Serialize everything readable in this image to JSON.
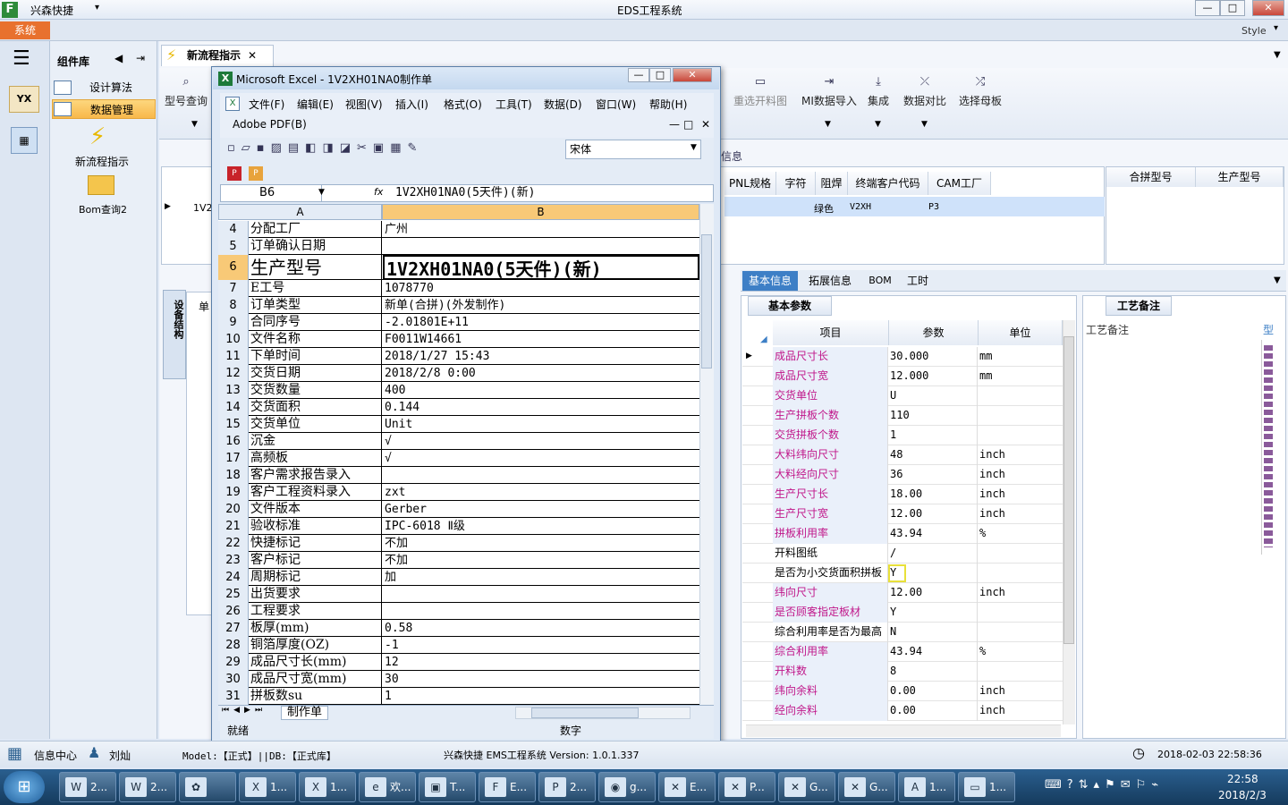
{
  "app": {
    "title": "EDS工程系统",
    "company": "兴森快捷",
    "style_label": "Style",
    "system_tab": "系统"
  },
  "window_controls": {
    "min": "—",
    "max": "□",
    "close": "✕"
  },
  "nav": {
    "header": "组件库",
    "items": [
      {
        "label": "设计算法"
      },
      {
        "label": "数据管理"
      }
    ],
    "tiles": [
      {
        "label": "新流程指示"
      },
      {
        "label": "Bom查询2"
      }
    ]
  },
  "main_tab": {
    "label": "新流程指示"
  },
  "toolbar": {
    "model_query": "型号查询",
    "buttons": [
      {
        "label": "重选开料图"
      },
      {
        "label": "MI数据导入"
      },
      {
        "label": "集成"
      },
      {
        "label": "数据对比"
      },
      {
        "label": "选择母板"
      }
    ]
  },
  "grid": {
    "info_label": "信息",
    "headers": [
      "PNL规格",
      "字符",
      "阻焊",
      "终端客户代码",
      "CAM工厂"
    ],
    "row_prefix": "1V2",
    "row": {
      "mask": "绿色",
      "code": "V2XH",
      "factory": "P3"
    },
    "right_headers": [
      "合拼型号",
      "生产型号"
    ]
  },
  "info_tabs": [
    "基本信息",
    "拓展信息",
    "BOM",
    "工时"
  ],
  "left_panel": {
    "tab": "单",
    "side": "设备结构"
  },
  "params": {
    "tab": "基本参数",
    "headers": {
      "item": "项目",
      "param": "参数",
      "unit": "单位"
    },
    "rows": [
      {
        "k": "成品尺寸长",
        "v": "30.000",
        "u": "mm",
        "m": true
      },
      {
        "k": "成品尺寸宽",
        "v": "12.000",
        "u": "mm",
        "m": true
      },
      {
        "k": "交货单位",
        "v": "U",
        "u": "",
        "m": true
      },
      {
        "k": "生产拼板个数",
        "v": "110",
        "u": "",
        "m": true
      },
      {
        "k": "交货拼板个数",
        "v": "1",
        "u": "",
        "m": true
      },
      {
        "k": "大料纬向尺寸",
        "v": "48",
        "u": "inch",
        "m": true
      },
      {
        "k": "大料经向尺寸",
        "v": "36",
        "u": "inch",
        "m": true
      },
      {
        "k": "生产尺寸长",
        "v": "18.00",
        "u": "inch",
        "m": true
      },
      {
        "k": "生产尺寸宽",
        "v": "12.00",
        "u": "inch",
        "m": true
      },
      {
        "k": "拼板利用率",
        "v": "43.94",
        "u": "%",
        "m": true
      },
      {
        "k": "开料图纸",
        "v": "/",
        "u": "",
        "m": false
      },
      {
        "k": "是否为小交货面积拼板",
        "v": "Y",
        "u": "",
        "m": false
      },
      {
        "k": "纬向尺寸",
        "v": "12.00",
        "u": "inch",
        "m": true
      },
      {
        "k": "是否顾客指定板材",
        "v": "Y",
        "u": "",
        "m": true
      },
      {
        "k": "综合利用率是否为最高",
        "v": "N",
        "u": "",
        "m": false
      },
      {
        "k": "综合利用率",
        "v": "43.94",
        "u": "%",
        "m": true
      },
      {
        "k": "开料数",
        "v": "8",
        "u": "",
        "m": true
      },
      {
        "k": "纬向余料",
        "v": "0.00",
        "u": "inch",
        "m": true
      },
      {
        "k": "经向余料",
        "v": "0.00",
        "u": "inch",
        "m": true
      }
    ]
  },
  "craft": {
    "tab": "工艺备注",
    "header": "工艺备注",
    "col": "型"
  },
  "excel": {
    "title": "Microsoft Excel - 1V2XH01NA0制作单",
    "menu": [
      "文件(F)",
      "编辑(E)",
      "视图(V)",
      "插入(I)",
      "格式(O)",
      "工具(T)",
      "数据(D)",
      "窗口(W)",
      "帮助(H)"
    ],
    "menu2": "Adobe PDF(B)",
    "font": "宋体",
    "cell_ref": "B6",
    "fx": "fx",
    "formula": "1V2XH01NA0(5天件)(新)",
    "col_a": "A",
    "col_b": "B",
    "rows": [
      {
        "n": "4",
        "a": "分配工厂",
        "b": "广州"
      },
      {
        "n": "5",
        "a": "订单确认日期",
        "b": ""
      },
      {
        "n": "6",
        "a": "生产型号",
        "b": "1V2XH01NA0(5天件)(新)",
        "big": true
      },
      {
        "n": "7",
        "a": "E工号",
        "b": "1078770"
      },
      {
        "n": "8",
        "a": "订单类型",
        "b": "新单(合拼)(外发制作)"
      },
      {
        "n": "9",
        "a": "合同序号",
        "b": "-2.01801E+11"
      },
      {
        "n": "10",
        "a": "文件名称",
        "b": "F0011W14661"
      },
      {
        "n": "11",
        "a": "下单时间",
        "b": "2018/1/27 15:43"
      },
      {
        "n": "12",
        "a": "交货日期",
        "b": "2018/2/8 0:00"
      },
      {
        "n": "13",
        "a": "交货数量",
        "b": "400"
      },
      {
        "n": "14",
        "a": "交货面积",
        "b": "0.144"
      },
      {
        "n": "15",
        "a": "交货单位",
        "b": "Unit"
      },
      {
        "n": "16",
        "a": "沉金",
        "b": "√"
      },
      {
        "n": "17",
        "a": "高频板",
        "b": "√"
      },
      {
        "n": "18",
        "a": "客户需求报告录入",
        "b": ""
      },
      {
        "n": "19",
        "a": "客户工程资料录入",
        "b": "zxt"
      },
      {
        "n": "20",
        "a": "文件版本",
        "b": "Gerber"
      },
      {
        "n": "21",
        "a": "验收标准",
        "b": "IPC-6018 Ⅱ级"
      },
      {
        "n": "22",
        "a": "快捷标记",
        "b": "不加"
      },
      {
        "n": "23",
        "a": "客户标记",
        "b": "不加"
      },
      {
        "n": "24",
        "a": "周期标记",
        "b": "加"
      },
      {
        "n": "25",
        "a": "出货要求",
        "b": ""
      },
      {
        "n": "26",
        "a": "工程要求",
        "b": ""
      },
      {
        "n": "27",
        "a": "板厚(mm)",
        "b": "0.58"
      },
      {
        "n": "28",
        "a": "铜箔厚度(OZ)",
        "b": "-1"
      },
      {
        "n": "29",
        "a": "成品尺寸长(mm)",
        "b": "12"
      },
      {
        "n": "30",
        "a": "成品尺寸宽(mm)",
        "b": "30"
      },
      {
        "n": "31",
        "a": "拼板数su",
        "b": "1"
      }
    ],
    "sheet_tab": "制作单",
    "status_left": "就绪",
    "status_mid": "数字"
  },
  "status": {
    "info_center": "信息中心",
    "user": "刘灿",
    "model_text": "Model:【正式】||DB:【正式库】",
    "system": "兴森快捷 EMS工程系统 Version: 1.0.1.337",
    "datetime": "2018-02-03 22:58:36"
  },
  "taskbar": {
    "items": [
      "2...",
      "2...",
      "",
      "1...",
      "1...",
      "欢...",
      "T...",
      "E...",
      "2...",
      "g...",
      "E...",
      "P...",
      "G...",
      "G...",
      "1...",
      "1..."
    ],
    "time": "22:58",
    "date": "2018/2/3"
  }
}
